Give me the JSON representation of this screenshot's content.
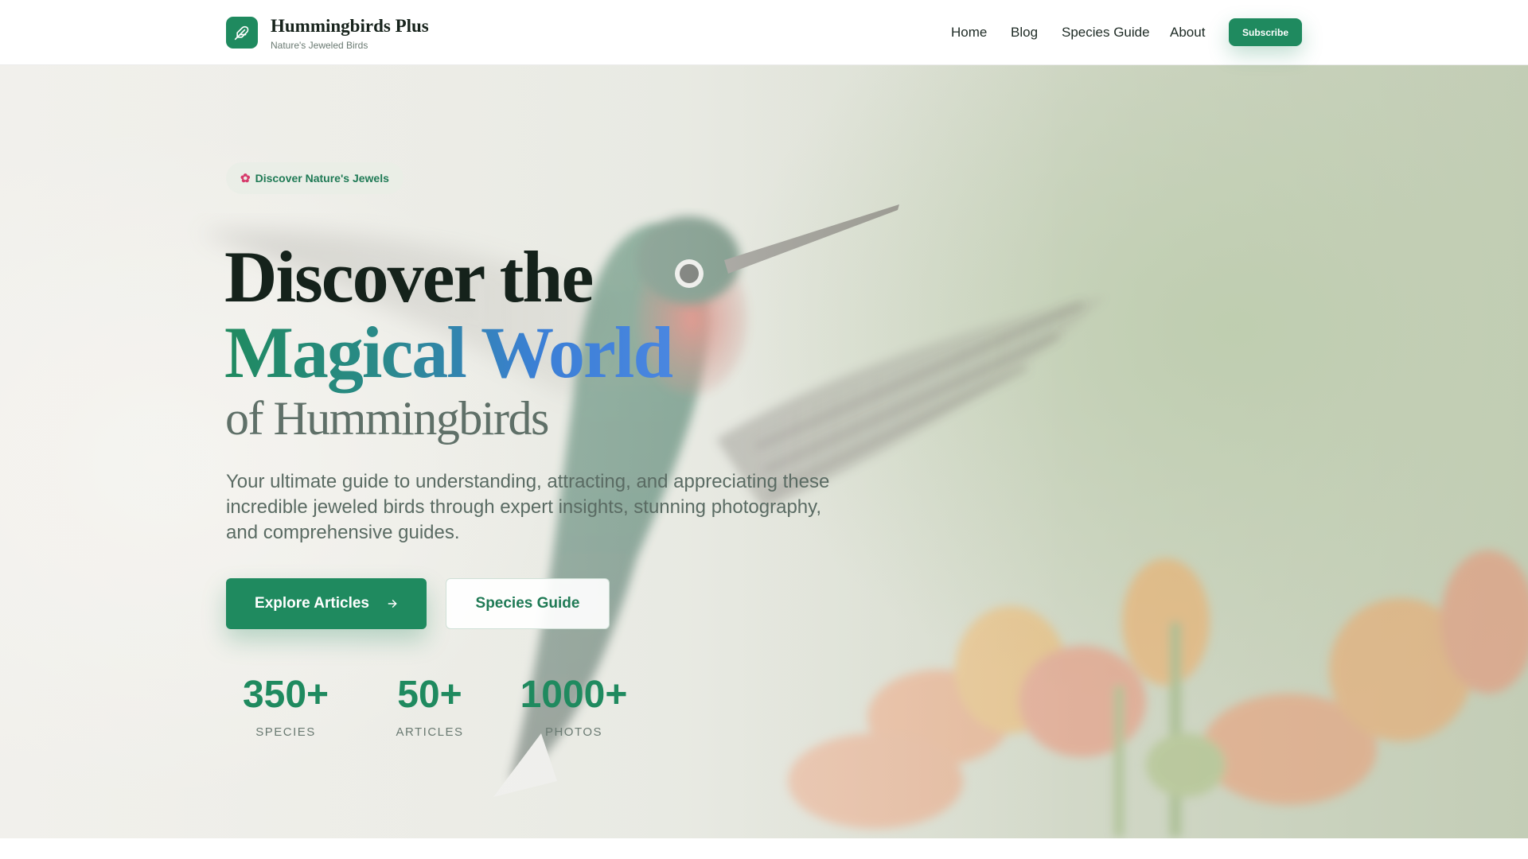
{
  "header": {
    "brand_title": "Hummingbirds Plus",
    "brand_subtitle": "Nature's Jeweled Birds",
    "nav": [
      "Home",
      "Blog",
      "Species Guide",
      "About"
    ],
    "subscribe_label": "Subscribe"
  },
  "hero": {
    "badge_text": "Discover Nature's Jewels",
    "badge_icon": "hibiscus-flower-icon",
    "title_line1": "Discover the",
    "title_line2": "Magical World",
    "title_line3": "of Hummingbirds",
    "description": "Your ultimate guide to understanding, attracting, and appreciating these incredible jeweled birds through expert insights, stunning photography, and comprehensive guides.",
    "primary_button": "Explore Articles",
    "secondary_button": "Species Guide",
    "stats": [
      {
        "value": "350+",
        "label": "SPECIES"
      },
      {
        "value": "50+",
        "label": "ARTICLES"
      },
      {
        "value": "1000+",
        "label": "PHOTOS"
      }
    ]
  },
  "colors": {
    "brand_green": "#1f8a5f",
    "title_dark": "#15221b",
    "gradient_blue": "#3b7fd6"
  }
}
